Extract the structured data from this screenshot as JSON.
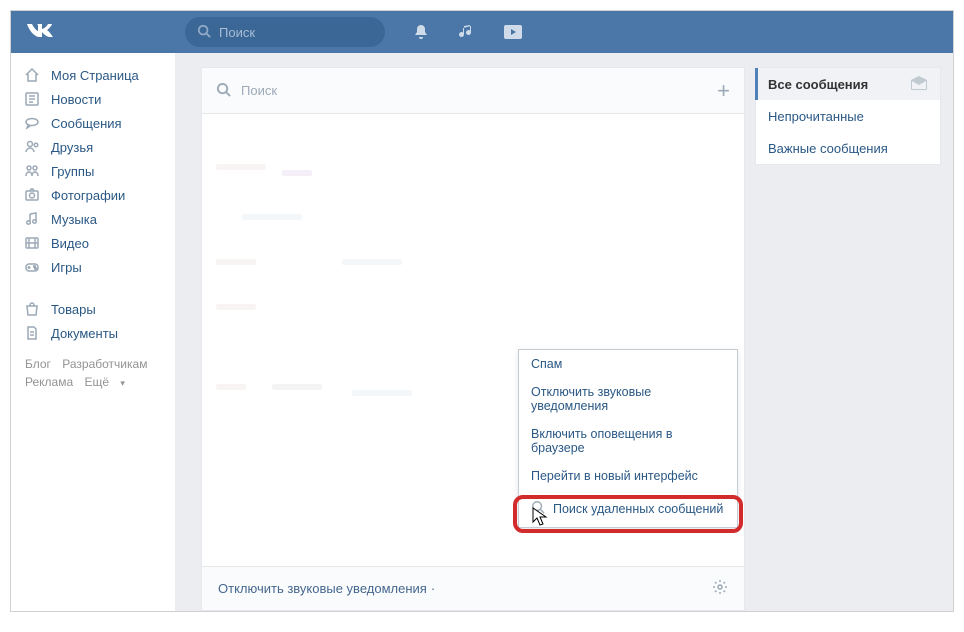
{
  "header": {
    "search_placeholder": "Поиск"
  },
  "sidebar": {
    "items": [
      {
        "label": "Моя Страница"
      },
      {
        "label": "Новости"
      },
      {
        "label": "Сообщения"
      },
      {
        "label": "Друзья"
      },
      {
        "label": "Группы"
      },
      {
        "label": "Фотографии"
      },
      {
        "label": "Музыка"
      },
      {
        "label": "Видео"
      },
      {
        "label": "Игры"
      }
    ],
    "items2": [
      {
        "label": "Товары"
      },
      {
        "label": "Документы"
      }
    ]
  },
  "footer": {
    "blog": "Блог",
    "devs": "Разработчикам",
    "ads": "Реклама",
    "more": "Ещё"
  },
  "messages": {
    "search_placeholder": "Поиск",
    "footer_text": "Отключить звуковые уведомления"
  },
  "filters": {
    "all": "Все сообщения",
    "unread": "Непрочитанные",
    "important": "Важные сообщения"
  },
  "popup": {
    "spam": "Спам",
    "mute": "Отключить звуковые уведомления",
    "browser_notify": "Включить оповещения в браузере",
    "new_iface": "Перейти в новый интерфейс",
    "search_deleted": "Поиск удаленных сообщений"
  }
}
